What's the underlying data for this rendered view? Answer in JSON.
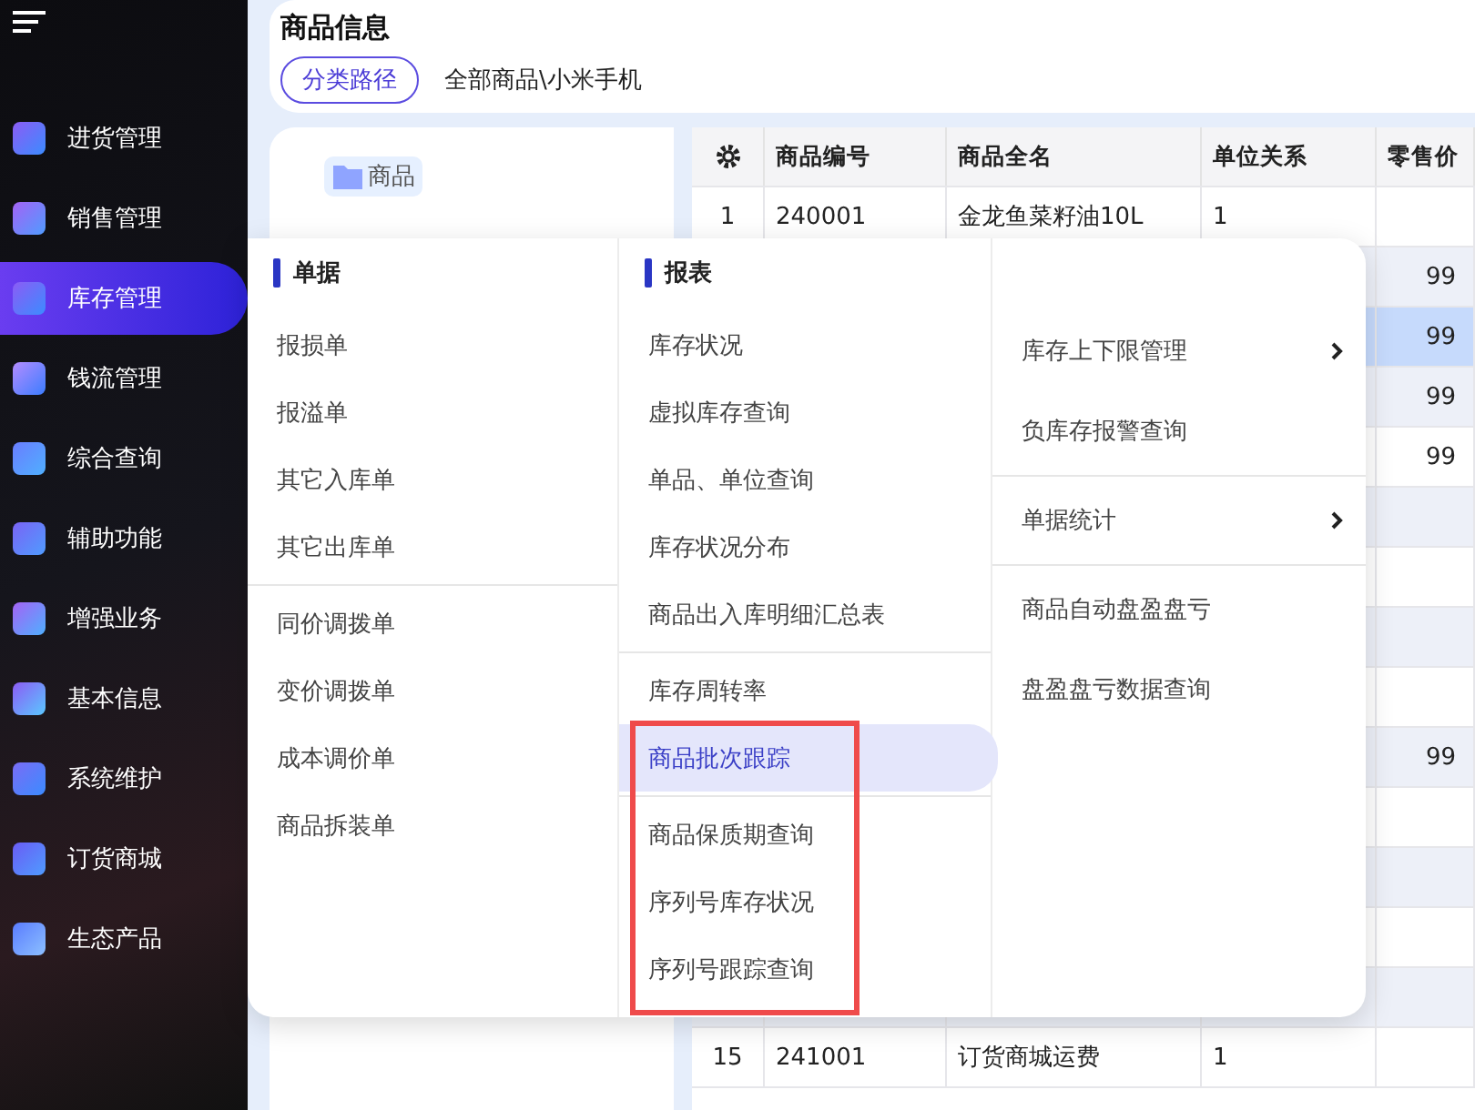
{
  "sidebar": {
    "items": [
      {
        "label": "进货管理",
        "selected": false
      },
      {
        "label": "销售管理",
        "selected": false
      },
      {
        "label": "库存管理",
        "selected": true
      },
      {
        "label": "钱流管理",
        "selected": false
      },
      {
        "label": "综合查询",
        "selected": false
      },
      {
        "label": "辅助功能",
        "selected": false
      },
      {
        "label": "增强业务",
        "selected": false
      },
      {
        "label": "基本信息",
        "selected": false
      },
      {
        "label": "系统维护",
        "selected": false
      },
      {
        "label": "订货商城",
        "selected": false
      },
      {
        "label": "生态产品",
        "selected": false
      }
    ]
  },
  "header": {
    "title": "商品信息",
    "path_button": "分类路径",
    "path": "全部商品\\小米手机"
  },
  "tree": {
    "root": "商品"
  },
  "table": {
    "columns": [
      "商品编号",
      "商品全名",
      "单位关系",
      "零售价"
    ],
    "rows": [
      {
        "index": "1",
        "code": "240001",
        "name": "金龙鱼菜籽油10L",
        "unit": "1",
        "selected": false
      },
      {
        "price": "99",
        "selected": false
      },
      {
        "price": "99",
        "selected": true
      },
      {
        "price": "99",
        "selected": false
      },
      {
        "price": "99",
        "selected": false
      },
      {
        "selected": false
      },
      {
        "selected": false
      },
      {
        "selected": false
      },
      {
        "selected": false
      },
      {
        "price": "99",
        "selected": false
      },
      {
        "selected": false
      },
      {
        "selected": false
      },
      {
        "selected": false
      },
      {
        "selected": false
      },
      {
        "index": "15",
        "code": "241001",
        "name": "订货商城运费",
        "unit": "1",
        "selected": false
      }
    ]
  },
  "menu": {
    "columns": [
      {
        "title": "单据",
        "groups": [
          [
            {
              "label": "报损单",
              "selected": false,
              "submenu": false
            },
            {
              "label": "报溢单",
              "selected": false,
              "submenu": false
            },
            {
              "label": "其它入库单",
              "selected": false,
              "submenu": false
            },
            {
              "label": "其它出库单",
              "selected": false,
              "submenu": false
            }
          ],
          [
            {
              "label": "同价调拨单",
              "selected": false,
              "submenu": false
            },
            {
              "label": "变价调拨单",
              "selected": false,
              "submenu": false
            },
            {
              "label": "成本调价单",
              "selected": false,
              "submenu": false
            },
            {
              "label": "商品拆装单",
              "selected": false,
              "submenu": false
            }
          ]
        ]
      },
      {
        "title": "报表",
        "groups": [
          [
            {
              "label": "库存状况",
              "selected": false,
              "submenu": false
            },
            {
              "label": "虚拟库存查询",
              "selected": false,
              "submenu": false
            },
            {
              "label": "单品、单位查询",
              "selected": false,
              "submenu": false
            },
            {
              "label": "库存状况分布",
              "selected": false,
              "submenu": false
            },
            {
              "label": "商品出入库明细汇总表",
              "selected": false,
              "submenu": false
            }
          ],
          [
            {
              "label": "库存周转率",
              "selected": false,
              "submenu": false
            },
            {
              "label": "商品批次跟踪",
              "selected": true,
              "submenu": false
            }
          ],
          [
            {
              "label": "商品保质期查询",
              "selected": false,
              "submenu": false
            },
            {
              "label": "序列号库存状况",
              "selected": false,
              "submenu": false
            },
            {
              "label": "序列号跟踪查询",
              "selected": false,
              "submenu": false
            }
          ]
        ]
      },
      {
        "groups": [
          [
            {
              "label": "库存上下限管理",
              "selected": false,
              "submenu": true
            },
            {
              "label": "负库存报警查询",
              "selected": false,
              "submenu": false
            }
          ],
          [
            {
              "label": "单据统计",
              "selected": false,
              "submenu": true
            }
          ],
          [
            {
              "label": "商品自动盘盈盘亏",
              "selected": false,
              "submenu": false
            },
            {
              "label": "盘盈盘亏数据查询",
              "selected": false,
              "submenu": false
            }
          ]
        ]
      }
    ]
  }
}
